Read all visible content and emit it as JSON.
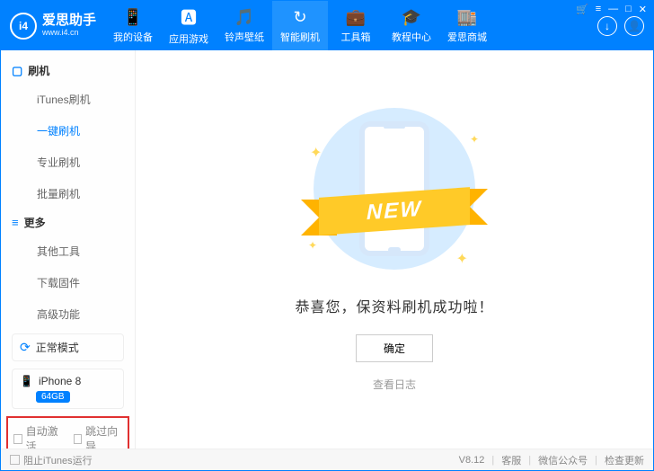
{
  "logo": {
    "badge": "i4",
    "title": "爱思助手",
    "subtitle": "www.i4.cn"
  },
  "nav": [
    {
      "label": "我的设备",
      "icon": "phone-icon"
    },
    {
      "label": "应用游戏",
      "icon": "app-icon"
    },
    {
      "label": "铃声壁纸",
      "icon": "note-icon"
    },
    {
      "label": "智能刷机",
      "icon": "refresh-icon"
    },
    {
      "label": "工具箱",
      "icon": "toolbox-icon"
    },
    {
      "label": "教程中心",
      "icon": "book-icon"
    },
    {
      "label": "爱思商城",
      "icon": "shop-icon"
    }
  ],
  "nav_active_index": 3,
  "sidebar": {
    "sections": [
      {
        "title": "刷机",
        "items": [
          "iTunes刷机",
          "一键刷机",
          "专业刷机",
          "批量刷机"
        ],
        "active_index": 1
      },
      {
        "title": "更多",
        "items": [
          "其他工具",
          "下载固件",
          "高级功能"
        ],
        "active_index": -1
      }
    ]
  },
  "status": {
    "label": "正常模式"
  },
  "device": {
    "name": "iPhone 8",
    "storage": "64GB"
  },
  "bottom_options": {
    "opt1": "自动激活",
    "opt2": "跳过向导"
  },
  "main": {
    "ribbon_text": "NEW",
    "success": "恭喜您，保资料刷机成功啦！",
    "ok": "确定",
    "view_log": "查看日志"
  },
  "footer": {
    "block_itunes": "阻止iTunes运行",
    "version": "V8.12",
    "support": "客服",
    "wechat": "微信公众号",
    "update": "检查更新"
  }
}
